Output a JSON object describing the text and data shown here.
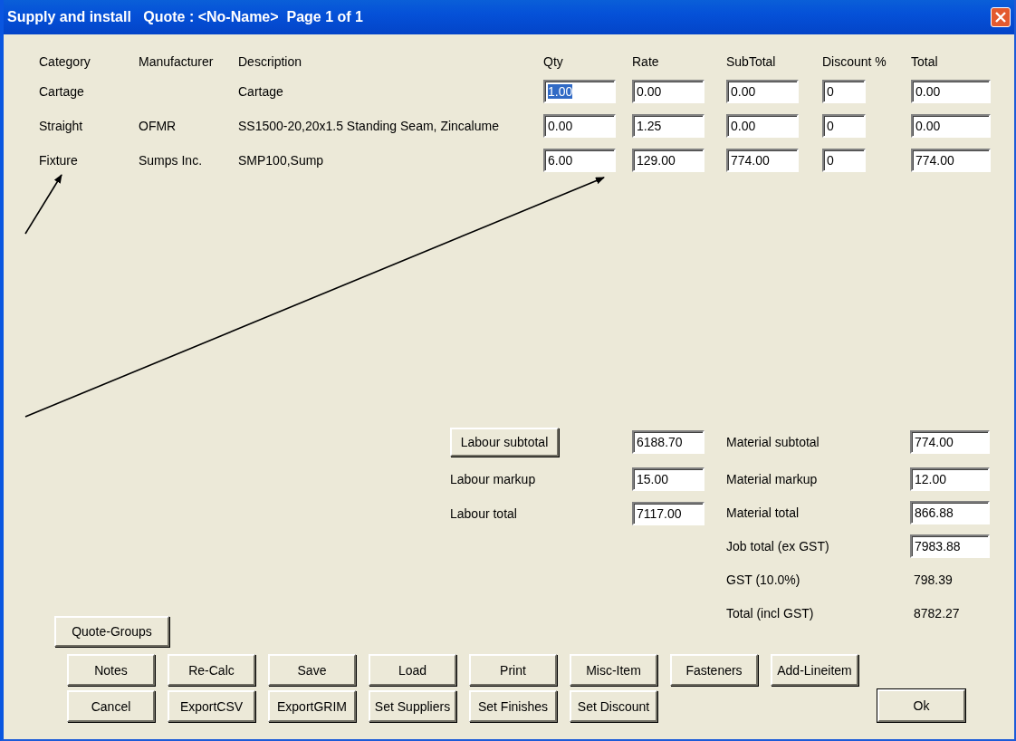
{
  "window": {
    "title": "Supply and install   Quote : <No-Name>  Page 1 of 1"
  },
  "columns": [
    "Category",
    "Manufacturer",
    "Description",
    "Qty",
    "Rate",
    "SubTotal",
    "Discount %",
    "Total"
  ],
  "rows": [
    {
      "category": "Cartage",
      "manufacturer": "",
      "description": "Cartage",
      "qty": "1.00",
      "qty_text_selected": true,
      "rate": "0.00",
      "subtotal": "0.00",
      "discount": "0",
      "total": "0.00"
    },
    {
      "category": "Straight",
      "manufacturer": "OFMR",
      "description": "SS1500-20,20x1.5 Standing Seam, Zincalume",
      "qty": "0.00",
      "qty_text_selected": false,
      "rate": "1.25",
      "subtotal": "0.00",
      "discount": "0",
      "total": "0.00"
    },
    {
      "category": "Fixture",
      "manufacturer": "Sumps Inc.",
      "description": "SMP100,Sump",
      "qty": "6.00",
      "qty_text_selected": false,
      "rate": "129.00",
      "subtotal": "774.00",
      "discount": "0",
      "total": "774.00"
    }
  ],
  "labour": [
    {
      "kind": "button",
      "label": "Labour subtotal",
      "value": "6188.70"
    },
    {
      "kind": "label",
      "label": "Labour markup",
      "value": "15.00"
    },
    {
      "kind": "label",
      "label": "Labour total",
      "value": "7117.00"
    }
  ],
  "material": [
    {
      "kind": "field",
      "label": "Material subtotal",
      "value": "774.00"
    },
    {
      "kind": "field",
      "label": "Material markup",
      "value": "12.00"
    },
    {
      "kind": "field",
      "label": "Material total",
      "value": "866.88"
    },
    {
      "kind": "field",
      "label": "Job total (ex GST)",
      "value": "7983.88"
    },
    {
      "kind": "text",
      "label": "GST (10.0%)",
      "value": "798.39"
    },
    {
      "kind": "text",
      "label": "Total (incl GST)",
      "value": "8782.27"
    }
  ],
  "quote_groups_button": "Quote-Groups",
  "button_rows": [
    [
      "Notes",
      "Re-Calc",
      "Save",
      "Load",
      "Print",
      "Misc-Item",
      "Fasteners",
      "Add-Lineitem"
    ],
    [
      "Cancel",
      "ExportCSV",
      "ExportGRIM",
      "Set Suppliers",
      "Set Finishes",
      "Set Discount"
    ]
  ],
  "ok_button": "Ok"
}
